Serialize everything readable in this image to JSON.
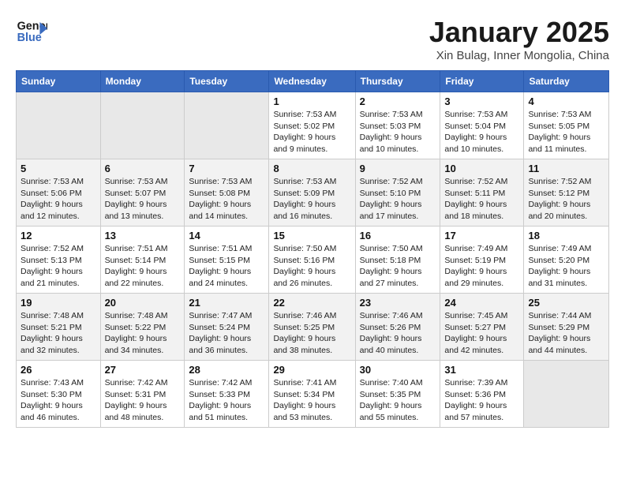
{
  "header": {
    "logo_line1": "General",
    "logo_line2": "Blue",
    "title": "January 2025",
    "subtitle": "Xin Bulag, Inner Mongolia, China"
  },
  "days_of_week": [
    "Sunday",
    "Monday",
    "Tuesday",
    "Wednesday",
    "Thursday",
    "Friday",
    "Saturday"
  ],
  "weeks": [
    [
      {
        "day": "",
        "info": ""
      },
      {
        "day": "",
        "info": ""
      },
      {
        "day": "",
        "info": ""
      },
      {
        "day": "1",
        "info": "Sunrise: 7:53 AM\nSunset: 5:02 PM\nDaylight: 9 hours\nand 9 minutes."
      },
      {
        "day": "2",
        "info": "Sunrise: 7:53 AM\nSunset: 5:03 PM\nDaylight: 9 hours\nand 10 minutes."
      },
      {
        "day": "3",
        "info": "Sunrise: 7:53 AM\nSunset: 5:04 PM\nDaylight: 9 hours\nand 10 minutes."
      },
      {
        "day": "4",
        "info": "Sunrise: 7:53 AM\nSunset: 5:05 PM\nDaylight: 9 hours\nand 11 minutes."
      }
    ],
    [
      {
        "day": "5",
        "info": "Sunrise: 7:53 AM\nSunset: 5:06 PM\nDaylight: 9 hours\nand 12 minutes."
      },
      {
        "day": "6",
        "info": "Sunrise: 7:53 AM\nSunset: 5:07 PM\nDaylight: 9 hours\nand 13 minutes."
      },
      {
        "day": "7",
        "info": "Sunrise: 7:53 AM\nSunset: 5:08 PM\nDaylight: 9 hours\nand 14 minutes."
      },
      {
        "day": "8",
        "info": "Sunrise: 7:53 AM\nSunset: 5:09 PM\nDaylight: 9 hours\nand 16 minutes."
      },
      {
        "day": "9",
        "info": "Sunrise: 7:52 AM\nSunset: 5:10 PM\nDaylight: 9 hours\nand 17 minutes."
      },
      {
        "day": "10",
        "info": "Sunrise: 7:52 AM\nSunset: 5:11 PM\nDaylight: 9 hours\nand 18 minutes."
      },
      {
        "day": "11",
        "info": "Sunrise: 7:52 AM\nSunset: 5:12 PM\nDaylight: 9 hours\nand 20 minutes."
      }
    ],
    [
      {
        "day": "12",
        "info": "Sunrise: 7:52 AM\nSunset: 5:13 PM\nDaylight: 9 hours\nand 21 minutes."
      },
      {
        "day": "13",
        "info": "Sunrise: 7:51 AM\nSunset: 5:14 PM\nDaylight: 9 hours\nand 22 minutes."
      },
      {
        "day": "14",
        "info": "Sunrise: 7:51 AM\nSunset: 5:15 PM\nDaylight: 9 hours\nand 24 minutes."
      },
      {
        "day": "15",
        "info": "Sunrise: 7:50 AM\nSunset: 5:16 PM\nDaylight: 9 hours\nand 26 minutes."
      },
      {
        "day": "16",
        "info": "Sunrise: 7:50 AM\nSunset: 5:18 PM\nDaylight: 9 hours\nand 27 minutes."
      },
      {
        "day": "17",
        "info": "Sunrise: 7:49 AM\nSunset: 5:19 PM\nDaylight: 9 hours\nand 29 minutes."
      },
      {
        "day": "18",
        "info": "Sunrise: 7:49 AM\nSunset: 5:20 PM\nDaylight: 9 hours\nand 31 minutes."
      }
    ],
    [
      {
        "day": "19",
        "info": "Sunrise: 7:48 AM\nSunset: 5:21 PM\nDaylight: 9 hours\nand 32 minutes."
      },
      {
        "day": "20",
        "info": "Sunrise: 7:48 AM\nSunset: 5:22 PM\nDaylight: 9 hours\nand 34 minutes."
      },
      {
        "day": "21",
        "info": "Sunrise: 7:47 AM\nSunset: 5:24 PM\nDaylight: 9 hours\nand 36 minutes."
      },
      {
        "day": "22",
        "info": "Sunrise: 7:46 AM\nSunset: 5:25 PM\nDaylight: 9 hours\nand 38 minutes."
      },
      {
        "day": "23",
        "info": "Sunrise: 7:46 AM\nSunset: 5:26 PM\nDaylight: 9 hours\nand 40 minutes."
      },
      {
        "day": "24",
        "info": "Sunrise: 7:45 AM\nSunset: 5:27 PM\nDaylight: 9 hours\nand 42 minutes."
      },
      {
        "day": "25",
        "info": "Sunrise: 7:44 AM\nSunset: 5:29 PM\nDaylight: 9 hours\nand 44 minutes."
      }
    ],
    [
      {
        "day": "26",
        "info": "Sunrise: 7:43 AM\nSunset: 5:30 PM\nDaylight: 9 hours\nand 46 minutes."
      },
      {
        "day": "27",
        "info": "Sunrise: 7:42 AM\nSunset: 5:31 PM\nDaylight: 9 hours\nand 48 minutes."
      },
      {
        "day": "28",
        "info": "Sunrise: 7:42 AM\nSunset: 5:33 PM\nDaylight: 9 hours\nand 51 minutes."
      },
      {
        "day": "29",
        "info": "Sunrise: 7:41 AM\nSunset: 5:34 PM\nDaylight: 9 hours\nand 53 minutes."
      },
      {
        "day": "30",
        "info": "Sunrise: 7:40 AM\nSunset: 5:35 PM\nDaylight: 9 hours\nand 55 minutes."
      },
      {
        "day": "31",
        "info": "Sunrise: 7:39 AM\nSunset: 5:36 PM\nDaylight: 9 hours\nand 57 minutes."
      },
      {
        "day": "",
        "info": ""
      }
    ]
  ]
}
